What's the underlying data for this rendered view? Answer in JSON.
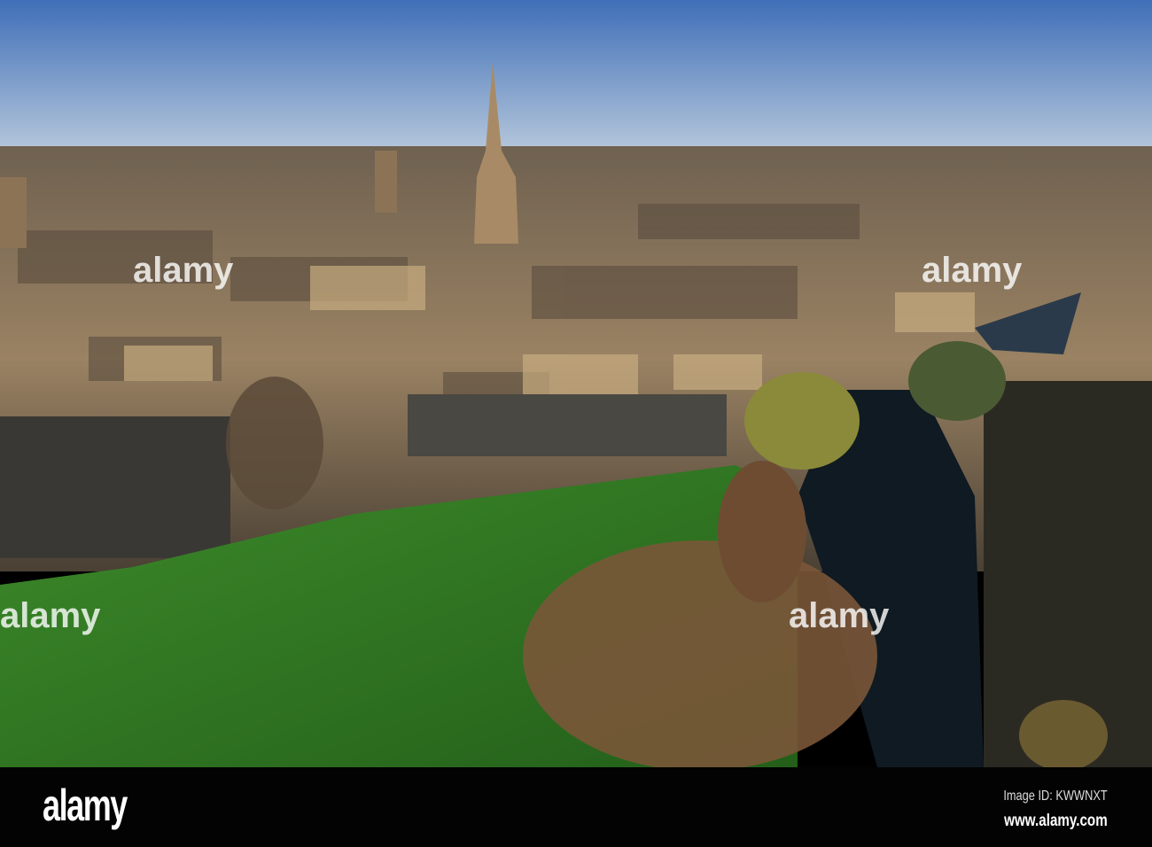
{
  "photo": {
    "subject": "Aerial view of town with church spire, river and green park"
  },
  "watermark": {
    "text": "alamy"
  },
  "footer": {
    "logo": "alamy",
    "image_id": "Image ID: KWWNXT",
    "website": "www.alamy.com"
  },
  "colors": {
    "sky_top": "#3f6fb8",
    "sky_horizon": "#b8c9dc",
    "grass": "#2f7a22",
    "river": "#0f1a22",
    "footer": "#030303"
  }
}
